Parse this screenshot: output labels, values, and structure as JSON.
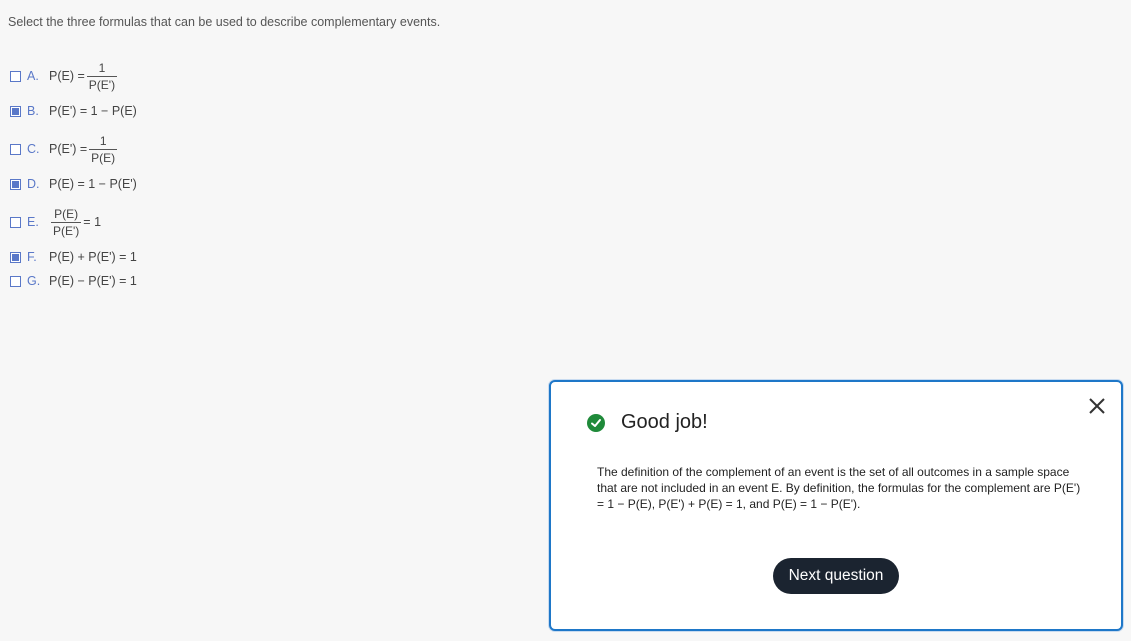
{
  "question": "Select the three formulas that can be used to describe complementary events.",
  "options": [
    {
      "letter": "A.",
      "checked": false,
      "lhs": "P(E) =",
      "num": "1",
      "den": "P(E')",
      "rhs": ""
    },
    {
      "letter": "B.",
      "checked": true,
      "text": "P(E') = 1 − P(E)"
    },
    {
      "letter": "C.",
      "checked": false,
      "lhs": "P(E') =",
      "num": "1",
      "den": "P(E)",
      "rhs": ""
    },
    {
      "letter": "D.",
      "checked": true,
      "text": "P(E) = 1 − P(E')"
    },
    {
      "letter": "E.",
      "checked": false,
      "lhs": "",
      "num": "P(E)",
      "den": "P(E')",
      "rhs": "= 1"
    },
    {
      "letter": "F.",
      "checked": true,
      "text": "P(E) + P(E') = 1"
    },
    {
      "letter": "G.",
      "checked": false,
      "text": "P(E) − P(E') = 1"
    }
  ],
  "feedback": {
    "title": "Good job!",
    "explanation": "The definition of the complement of an event is the set of all outcomes in a sample space that are not included in an event E. By definition, the formulas for the complement are P(E') = 1 − P(E), P(E') + P(E) = 1, and P(E) = 1 − P(E').",
    "next_label": "Next question",
    "icons": {
      "success": "check-circle-icon",
      "close": "close-icon"
    },
    "colors": {
      "accent": "#1e77c8",
      "success": "#1f8a3a",
      "button": "#1b2430"
    }
  }
}
